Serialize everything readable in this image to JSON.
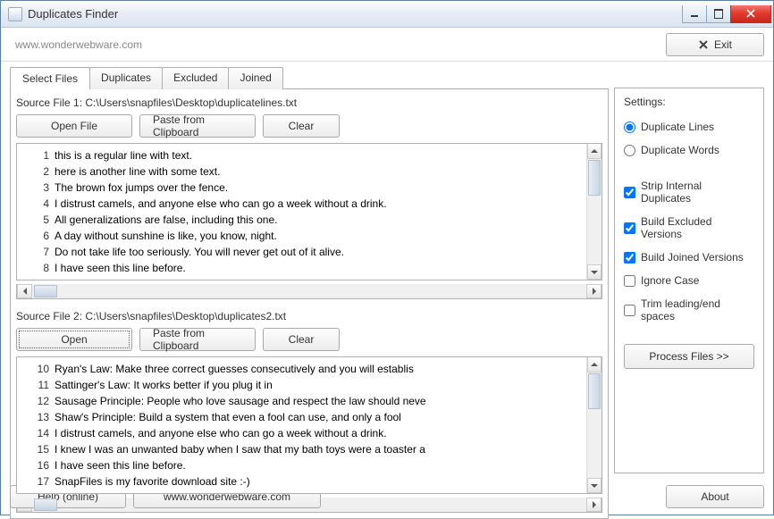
{
  "window": {
    "title": "Duplicates Finder"
  },
  "toolbar": {
    "url": "www.wonderwebware.com",
    "exit": "Exit"
  },
  "tabs": [
    "Select Files",
    "Duplicates",
    "Excluded",
    "Joined"
  ],
  "source1": {
    "label": "Source File 1: C:\\Users\\snapfiles\\Desktop\\duplicatelines.txt",
    "open": "Open File",
    "paste": "Paste from Clipboard",
    "clear": "Clear",
    "lines": [
      "this is a regular line with text.",
      "here is another line with some text.",
      "The brown fox jumps over the fence.",
      "I distrust camels, and anyone else who can go a week without a drink.",
      "All generalizations are false, including this one.",
      "A day without sunshine is like, you know, night.",
      "Do not take life too seriously. You will never get out of it alive.",
      "I have seen this line before."
    ],
    "start": 1
  },
  "source2": {
    "label": "Source File 2: C:\\Users\\snapfiles\\Desktop\\duplicates2.txt",
    "open": "Open",
    "paste": "Paste from Clipboard",
    "clear": "Clear",
    "lines": [
      "Ryan's Law: Make three correct guesses consecutively and you will establis",
      "Sattinger's Law: It works better if you plug it in",
      "Sausage Principle: People who love sausage and respect the law should neve",
      "Shaw's Principle: Build a system that even a fool can use, and only a fool",
      "I distrust camels, and anyone else who can go a week without a drink.",
      "I knew I was an unwanted baby when I saw that my bath toys were a toaster a",
      "I have seen this line before.",
      "SnapFiles is my favorite download site :-)"
    ],
    "start": 10
  },
  "settings": {
    "header": "Settings:",
    "radio_lines": "Duplicate Lines",
    "radio_words": "Duplicate Words",
    "chk_strip": "Strip Internal Duplicates",
    "chk_excluded": "Build Excluded Versions",
    "chk_joined": "Build Joined Versions",
    "chk_ignore": "Ignore Case",
    "chk_trim": "Trim leading/end spaces",
    "process": "Process Files  >>"
  },
  "footer": {
    "help": "Help (online)",
    "site": "www.wonderwebware.com",
    "about": "About"
  }
}
